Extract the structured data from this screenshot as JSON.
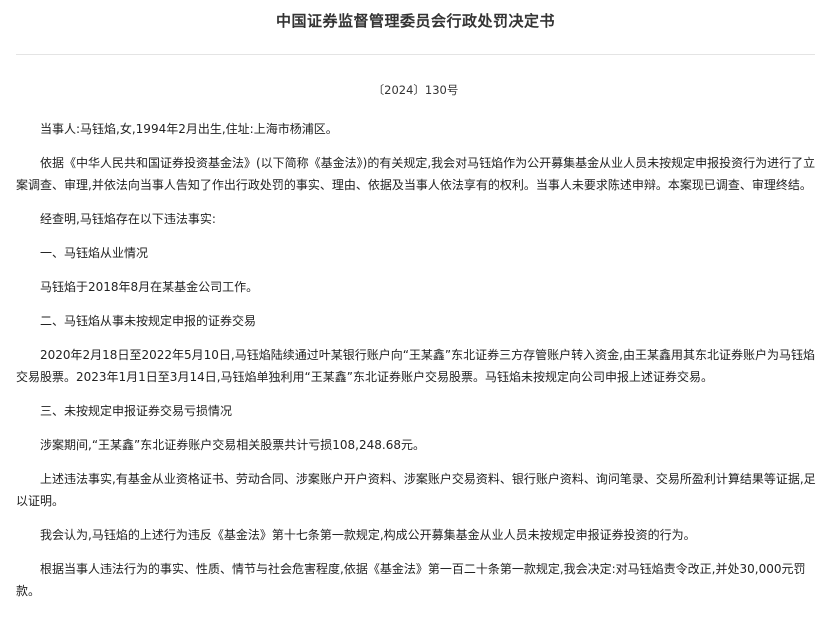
{
  "document": {
    "title": "中国证券监督管理委员会行政处罚决定书",
    "number": "〔2024〕130号",
    "paragraphs": [
      "当事人:马钰焰,女,1994年2月出生,住址:上海市杨浦区。",
      "依据《中华人民共和国证券投资基金法》(以下简称《基金法》)的有关规定,我会对马钰焰作为公开募集基金从业人员未按规定申报投资行为进行了立案调查、审理,并依法向当事人告知了作出行政处罚的事实、理由、依据及当事人依法享有的权利。当事人未要求陈述申辩。本案现已调查、审理终结。",
      "经查明,马钰焰存在以下违法事实:",
      "一、马钰焰从业情况",
      "马钰焰于2018年8月在某基金公司工作。",
      "二、马钰焰从事未按规定申报的证券交易",
      "2020年2月18日至2022年5月10日,马钰焰陆续通过叶某银行账户向“王某鑫”东北证券三方存管账户转入资金,由王某鑫用其东北证券账户为马钰焰交易股票。2023年1月1日至3月14日,马钰焰单独利用“王某鑫”东北证券账户交易股票。马钰焰未按规定向公司申报上述证券交易。",
      "三、未按规定申报证券交易亏损情况",
      "涉案期间,“王某鑫”东北证券账户交易相关股票共计亏损108,248.68元。",
      "上述违法事实,有基金从业资格证书、劳动合同、涉案账户开户资料、涉案账户交易资料、银行账户资料、询问笔录、交易所盈利计算结果等证据,足以证明。",
      "我会认为,马钰焰的上述行为违反《基金法》第十七条第一款规定,构成公开募集基金从业人员未按规定申报证券投资的行为。",
      "根据当事人违法行为的事实、性质、情节与社会危害程度,依据《基金法》第一百二十条第一款规定,我会决定:对马钰焰责令改正,并处30,000元罚款。"
    ]
  }
}
